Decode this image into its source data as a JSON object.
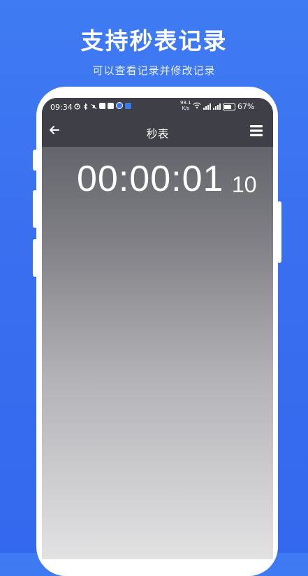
{
  "promo": {
    "headline": "支持秒表记录",
    "subline": "可以查看记录并修改记录"
  },
  "status_bar": {
    "time": "09:34",
    "network_speed_value": "98.1",
    "network_speed_unit": "K/s",
    "battery": "67%"
  },
  "app_bar": {
    "back_icon": "arrow-left-icon",
    "title": "秒表",
    "menu_icon": "hamburger-menu-icon"
  },
  "stopwatch": {
    "time": "00:00:01",
    "hundredths": "10"
  },
  "colors": {
    "background": "#3a6ff0",
    "app_bar": "#3e3f47",
    "text": "#ffffff"
  }
}
